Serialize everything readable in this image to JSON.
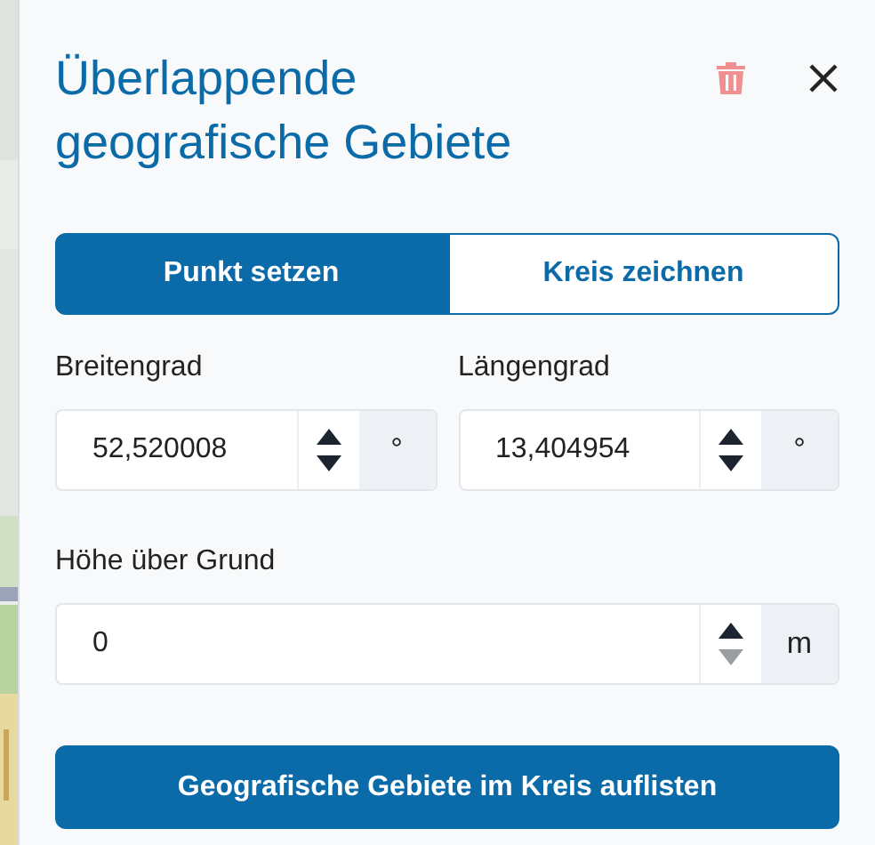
{
  "panel": {
    "title": "Überlappende geografische Gebiete"
  },
  "mode_tabs": [
    {
      "label": "Punkt setzen",
      "selected": true
    },
    {
      "label": "Kreis zeichnen",
      "selected": false
    }
  ],
  "coordinate_fields": [
    {
      "label": "Breitengrad",
      "value": "52,520008",
      "unit": "°",
      "up_disabled": false,
      "down_disabled": false
    },
    {
      "label": "Längengrad",
      "value": "13,404954",
      "unit": "°",
      "up_disabled": false,
      "down_disabled": false
    }
  ],
  "height_field": {
    "label": "Höhe über Grund",
    "value": "0",
    "unit": "m",
    "up_disabled": false,
    "down_disabled": true
  },
  "submit_button": {
    "label": "Geografische Gebiete im Kreis auflisten"
  }
}
